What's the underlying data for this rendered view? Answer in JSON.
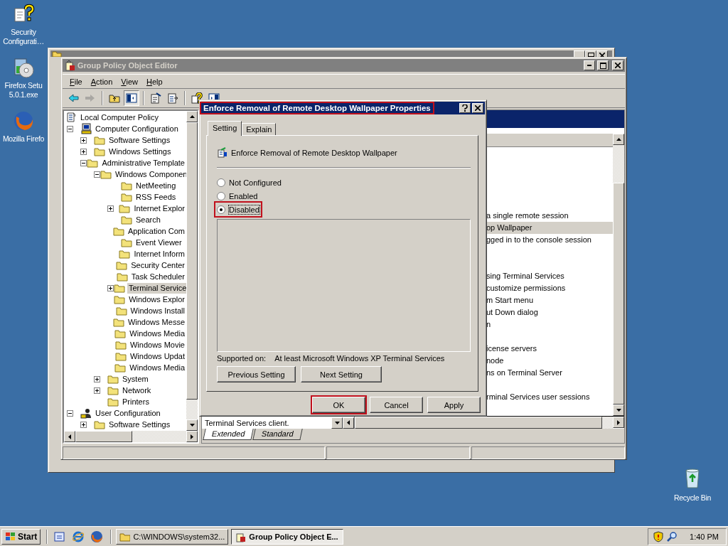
{
  "desktop_icons": [
    {
      "kind": "security",
      "lines": [
        "Security",
        "Configurati…"
      ]
    },
    {
      "kind": "installer",
      "lines": [
        "Firefox Setu",
        "5.0.1.exe"
      ]
    },
    {
      "kind": "firefox",
      "lines": [
        "Mozilla Firefo"
      ]
    }
  ],
  "recycle_bin": {
    "label": "Recycle Bin"
  },
  "gpo_window": {
    "title": "Group Policy Object Editor",
    "active": false,
    "menu": [
      "File",
      "Action",
      "View",
      "Help"
    ],
    "toolbar": [
      {
        "kind": "back",
        "disabled": false,
        "pressed": false
      },
      {
        "kind": "forward",
        "disabled": true,
        "pressed": false
      },
      {
        "kind": "separator"
      },
      {
        "kind": "up",
        "disabled": false,
        "pressed": false
      },
      {
        "kind": "tree",
        "disabled": false,
        "pressed": true
      },
      {
        "kind": "separator"
      },
      {
        "kind": "properties",
        "disabled": false,
        "pressed": false
      },
      {
        "kind": "export",
        "disabled": false,
        "pressed": false
      },
      {
        "kind": "separator"
      },
      {
        "kind": "help",
        "disabled": false,
        "pressed": false
      },
      {
        "kind": "panel",
        "disabled": false,
        "pressed": false
      }
    ],
    "tree": [
      {
        "label": "Local Computer Policy",
        "kind": "policy",
        "selected": false,
        "children": [
          {
            "label": "Computer Configuration",
            "kind": "computer",
            "expanded": true,
            "selected": false,
            "children": [
              {
                "label": "Software Settings",
                "kind": "folder",
                "expanded": false,
                "selected": false
              },
              {
                "label": "Windows Settings",
                "kind": "folder",
                "expanded": false,
                "selected": false
              },
              {
                "label": "Administrative Template",
                "kind": "folder",
                "expanded": true,
                "selected": false,
                "children": [
                  {
                    "label": "Windows Componen",
                    "kind": "folder",
                    "expanded": true,
                    "selected": false,
                    "children": [
                      {
                        "label": "NetMeeting",
                        "kind": "folder",
                        "selected": false
                      },
                      {
                        "label": "RSS Feeds",
                        "kind": "folder",
                        "selected": false
                      },
                      {
                        "label": "Internet Explor",
                        "kind": "folder",
                        "expanded": false,
                        "selected": false
                      },
                      {
                        "label": "Search",
                        "kind": "folder",
                        "selected": false
                      },
                      {
                        "label": "Application Com",
                        "kind": "folder",
                        "selected": false
                      },
                      {
                        "label": "Event Viewer",
                        "kind": "folder",
                        "selected": false
                      },
                      {
                        "label": "Internet Inform",
                        "kind": "folder",
                        "selected": false
                      },
                      {
                        "label": "Security Center",
                        "kind": "folder",
                        "selected": false
                      },
                      {
                        "label": "Task Scheduler",
                        "kind": "folder",
                        "selected": false
                      },
                      {
                        "label": "Terminal Service",
                        "kind": "folder",
                        "expanded": false,
                        "selected": true
                      },
                      {
                        "label": "Windows Explor",
                        "kind": "folder",
                        "selected": false
                      },
                      {
                        "label": "Windows Install",
                        "kind": "folder",
                        "selected": false
                      },
                      {
                        "label": "Windows Messe",
                        "kind": "folder",
                        "selected": false
                      },
                      {
                        "label": "Windows Media",
                        "kind": "folder",
                        "selected": false
                      },
                      {
                        "label": "Windows Movie",
                        "kind": "folder",
                        "selected": false
                      },
                      {
                        "label": "Windows Updat",
                        "kind": "folder",
                        "selected": false
                      },
                      {
                        "label": "Windows Media",
                        "kind": "folder",
                        "selected": false
                      }
                    ]
                  },
                  {
                    "label": "System",
                    "kind": "folder",
                    "expanded": false,
                    "selected": false
                  },
                  {
                    "label": "Network",
                    "kind": "folder",
                    "expanded": false,
                    "selected": false
                  },
                  {
                    "label": "Printers",
                    "kind": "folder",
                    "selected": false
                  }
                ]
              }
            ]
          },
          {
            "label": "User Configuration",
            "kind": "user",
            "expanded": true,
            "selected": false,
            "children": [
              {
                "label": "Software Settings",
                "kind": "folder",
                "expanded": false,
                "selected": false
              }
            ]
          }
        ]
      }
    ],
    "rows": [
      {
        "selected": false
      },
      {
        "selected": false
      },
      {
        "selected": false
      },
      {
        "selected": false
      },
      {
        "selected": false
      },
      {
        "label": "a single remote session",
        "selected": false
      },
      {
        "label": "op Wallpaper",
        "selected": true
      },
      {
        "label": "gged in to the console session",
        "selected": false
      },
      {
        "selected": false
      },
      {
        "selected": false
      },
      {
        "label": "sing Terminal Services",
        "selected": false
      },
      {
        "label": "customize permissions",
        "selected": false
      },
      {
        "label": "m Start menu",
        "selected": false
      },
      {
        "label": "ut Down dialog",
        "selected": false
      },
      {
        "label": "n",
        "selected": false
      },
      {
        "selected": false
      },
      {
        "label": "icense servers",
        "selected": false
      },
      {
        "label": "node",
        "selected": false
      },
      {
        "label": "ns on Terminal Server",
        "selected": false
      },
      {
        "selected": false
      },
      {
        "label": "rminal Services user sessions",
        "selected": false
      },
      {
        "selected": false
      }
    ],
    "description": "Terminal Services client.",
    "view_tabs": [
      {
        "label": "Extended",
        "selected": true
      },
      {
        "label": "Standard",
        "selected": false
      }
    ]
  },
  "dialog": {
    "title": "Enforce Removal of Remote Desktop Wallpaper Properties",
    "title_highlighted": true,
    "tabs": [
      {
        "label": "Setting",
        "selected": true
      },
      {
        "label": "Explain",
        "selected": false
      }
    ],
    "policy": "Enforce Removal of Remote Desktop Wallpaper",
    "options": [
      {
        "label": "Not Configured",
        "selected": false,
        "highlighted": false
      },
      {
        "label": "Enabled",
        "selected": false,
        "highlighted": false
      },
      {
        "label": "Disabled",
        "selected": true,
        "highlighted": true
      }
    ],
    "supported_label": "Supported on:",
    "supported_value": "At least Microsoft Windows XP Terminal Services",
    "nav_buttons": [
      "Previous Setting",
      "Next Setting"
    ],
    "buttons": [
      {
        "label": "OK",
        "highlighted": true
      },
      {
        "label": "Cancel",
        "highlighted": false
      },
      {
        "label": "Apply",
        "highlighted": false
      }
    ]
  },
  "taskbar": {
    "start": "Start",
    "quick_launch": [
      {
        "kind": "desktop"
      },
      {
        "kind": "ie"
      },
      {
        "kind": "firefox"
      }
    ],
    "tasks": [
      {
        "label": "C:\\WINDOWS\\system32...",
        "kind": "explorer",
        "selected": false
      },
      {
        "label": "Group Policy Object E...",
        "kind": "gpo",
        "selected": true
      }
    ],
    "clock": "1:40 PM"
  }
}
